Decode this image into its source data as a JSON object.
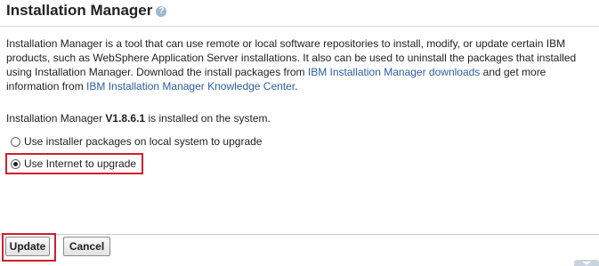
{
  "header": {
    "title": "Installation Manager",
    "help_icon_glyph": "?"
  },
  "description": {
    "text_1": "Installation Manager is a tool that can use remote or local software repositories to install, modify, or update certain IBM products, such as WebSphere Application Server installations. It also can be used to uninstall the packages that installed using Installation Manager. Download the install packages from ",
    "link_1": "IBM Installation Manager downloads",
    "text_2": " and get more information from ",
    "link_2": "IBM Installation Manager Knowledge Center",
    "text_3": "."
  },
  "version": {
    "prefix": "Installation Manager ",
    "value": "V1.8.6.1",
    "suffix": " is installed on the system."
  },
  "options": {
    "local_label": "Use installer packages on local system to upgrade",
    "local_checked": false,
    "internet_label": "Use Internet to upgrade",
    "internet_checked": true
  },
  "buttons": {
    "update_label": "Update",
    "cancel_label": "Cancel"
  },
  "colors": {
    "highlight": "#d11f2b",
    "link": "#2c5fa0",
    "help_icon": "#9fb7cf"
  },
  "icons": {
    "help": "help-icon",
    "scroll": "chevron-down-icon"
  }
}
